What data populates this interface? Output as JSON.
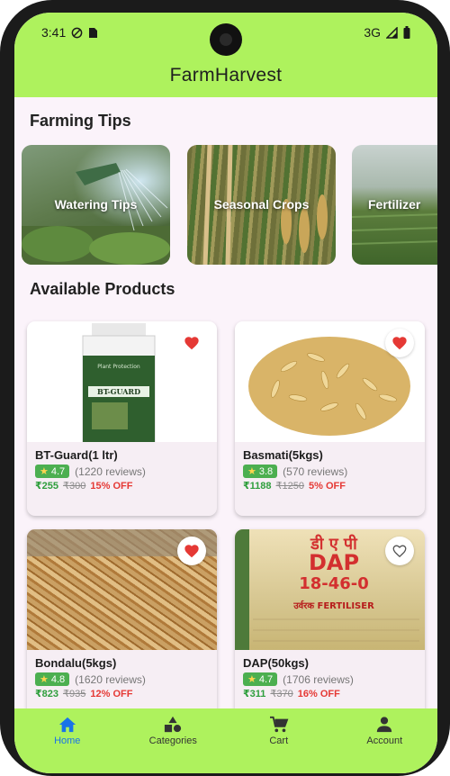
{
  "status": {
    "time": "3:41",
    "network": "3G"
  },
  "app": {
    "title": "FarmHarvest"
  },
  "sections": {
    "tips_title": "Farming Tips",
    "products_title": "Available Products"
  },
  "tips": [
    {
      "label": "Watering Tips"
    },
    {
      "label": "Seasonal Crops"
    },
    {
      "label": "Fertilizer"
    }
  ],
  "products": [
    {
      "name": "BT-Guard(1 ltr)",
      "rating": "4.7",
      "reviews": "(1220 reviews)",
      "price": "₹255",
      "mrp": "₹300",
      "off": "15% OFF",
      "favorite": true
    },
    {
      "name": "Basmati(5kgs)",
      "rating": "3.8",
      "reviews": "(570 reviews)",
      "price": "₹1188",
      "mrp": "₹1250",
      "off": "5% OFF",
      "favorite": true
    },
    {
      "name": "Bondalu(5kgs)",
      "rating": "4.8",
      "reviews": "(1620 reviews)",
      "price": "₹823",
      "mrp": "₹935",
      "off": "12% OFF",
      "favorite": true
    },
    {
      "name": "DAP(50kgs)",
      "rating": "4.7",
      "reviews": "(1706 reviews)",
      "price": "₹311",
      "mrp": "₹370",
      "off": "16% OFF",
      "favorite": false
    }
  ],
  "product_images": {
    "bottle_text": "BT-GUARD",
    "bottle_sub": "Plant Protection",
    "bag_text_top": "डी ए पी",
    "bag_text_main": "DAP",
    "bag_text_ratio": "18-46-0",
    "bag_text_line": "उर्वरक FERTILISER"
  },
  "nav": [
    {
      "label": "Home",
      "icon": "home-icon",
      "active": true
    },
    {
      "label": "Categories",
      "icon": "categories-icon",
      "active": false
    },
    {
      "label": "Cart",
      "icon": "cart-icon",
      "active": false
    },
    {
      "label": "Account",
      "icon": "account-icon",
      "active": false
    }
  ],
  "colors": {
    "accent": "#aef25d",
    "price": "#2e9e3c",
    "discount": "#e53935",
    "rating": "#4caf50",
    "nav_active": "#1a73e8",
    "favorite": "#e53935"
  }
}
